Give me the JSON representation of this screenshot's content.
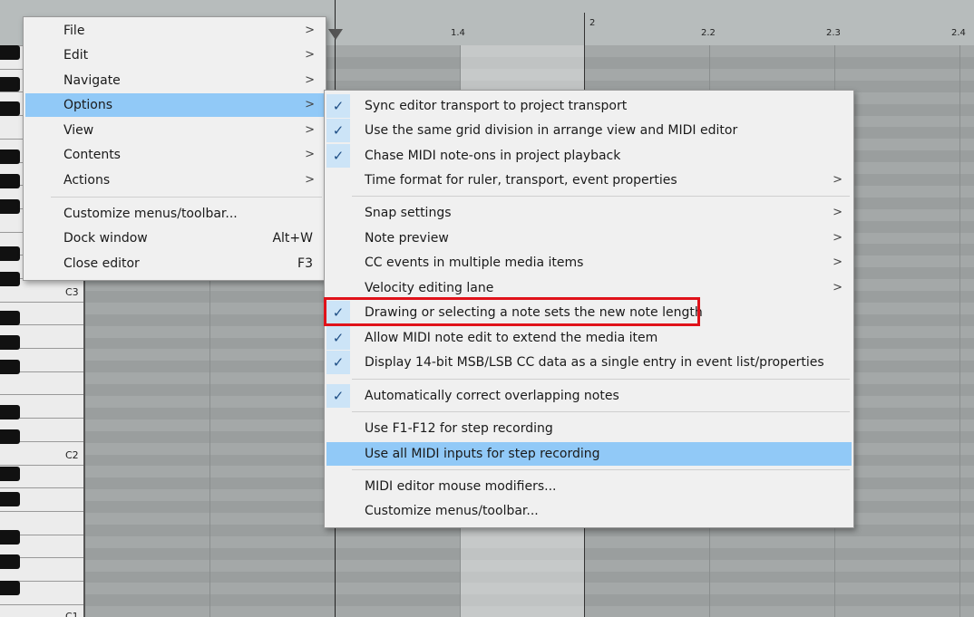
{
  "ruler": {
    "labels": [
      "1.4",
      "2",
      "2.2",
      "2.3",
      "2.4"
    ]
  },
  "piano": {
    "octave_labels": [
      "C3",
      "C2",
      "C1"
    ]
  },
  "menu": {
    "items": [
      {
        "label": "File",
        "arrow": ">"
      },
      {
        "label": "Edit",
        "arrow": ">"
      },
      {
        "label": "Navigate",
        "arrow": ">"
      },
      {
        "label": "Options",
        "arrow": ">"
      },
      {
        "label": "View",
        "arrow": ">"
      },
      {
        "label": "Contents",
        "arrow": ">"
      },
      {
        "label": "Actions",
        "arrow": ">"
      },
      {
        "label": "Customize menus/toolbar..."
      },
      {
        "label": "Dock window",
        "shortcut": "Alt+W"
      },
      {
        "label": "Close editor",
        "shortcut": "F3"
      }
    ]
  },
  "submenu": {
    "check_glyph": "✓",
    "items": [
      {
        "label": "Sync editor transport to project transport",
        "checked": true
      },
      {
        "label": "Use the same grid division in arrange view and MIDI editor",
        "checked": true
      },
      {
        "label": "Chase MIDI note-ons in project playback",
        "checked": true
      },
      {
        "label": "Time format for ruler, transport, event properties",
        "arrow": ">"
      },
      {
        "label": "Snap settings",
        "arrow": ">"
      },
      {
        "label": "Note preview",
        "arrow": ">"
      },
      {
        "label": "CC events in multiple media items",
        "arrow": ">"
      },
      {
        "label": "Velocity editing lane",
        "arrow": ">"
      },
      {
        "label": "Drawing or selecting a note sets the new note length",
        "checked": true
      },
      {
        "label": "Allow MIDI note edit to extend the media item",
        "checked": true
      },
      {
        "label": "Display 14-bit MSB/LSB CC data as a single entry in event list/properties",
        "checked": true
      },
      {
        "label": "Automatically correct overlapping notes",
        "checked": true
      },
      {
        "label": "Use F1-F12 for step recording"
      },
      {
        "label": "Use all MIDI inputs for step recording"
      },
      {
        "label": "MIDI editor mouse modifiers..."
      },
      {
        "label": "Customize menus/toolbar..."
      }
    ]
  },
  "colors": {
    "highlight": "#91c9f7",
    "check_bg": "#cce4f7",
    "annotation": "#e0121a"
  }
}
